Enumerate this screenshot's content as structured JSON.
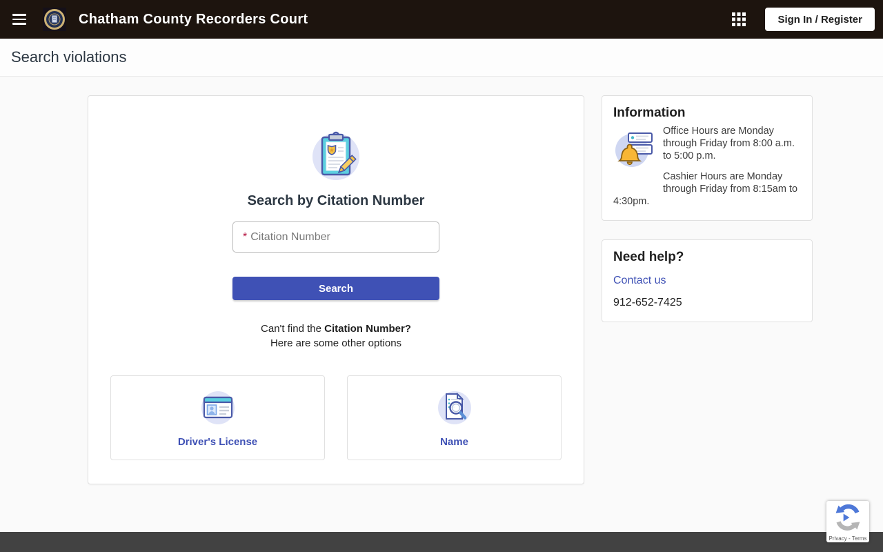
{
  "header": {
    "title": "Chatham County Recorders Court",
    "sign_in_label": "Sign In / Register"
  },
  "page": {
    "title": "Search violations"
  },
  "search_card": {
    "heading": "Search by Citation Number",
    "citation_input": {
      "required_mark": "*",
      "placeholder": "Citation Number"
    },
    "search_button": "Search",
    "cant_find": {
      "prefix": "Can't find the ",
      "bold": "Citation Number?",
      "line2": "Here are some other options"
    },
    "options": [
      {
        "label": "Driver's License"
      },
      {
        "label": "Name"
      }
    ]
  },
  "info_card": {
    "title": "Information",
    "office_hours": "Office Hours are Monday through Friday from 8:00 a.m. to 5:00 p.m.",
    "cashier_hours": "Cashier Hours are Monday through Friday from 8:15am to 4:30pm."
  },
  "help_card": {
    "title": "Need help?",
    "contact_link": "Contact us",
    "phone": "912-652-7425"
  },
  "recaptcha": {
    "label": "Privacy - Terms"
  },
  "colors": {
    "accent": "#3f51b5",
    "header_bg": "#1d140e",
    "footer_bg": "#424242",
    "required_mark": "#b4123f"
  }
}
